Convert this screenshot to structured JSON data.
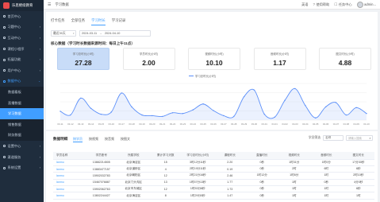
{
  "app": {
    "name": "乐思继续教育",
    "breadcrumb": "学习数据",
    "header_items": [
      {
        "label": "英语",
        "icon": "language-icon"
      },
      {
        "label": "使用帮助",
        "icon": "help-icon"
      },
      {
        "label": "任务中心",
        "icon": "task-icon"
      }
    ],
    "user_name": "admin..."
  },
  "sidebar": {
    "items": [
      {
        "label": "首页中心",
        "level": "top",
        "arrow": "",
        "active": false
      },
      {
        "label": "习题中心",
        "level": "top",
        "arrow": "›",
        "active": false
      },
      {
        "label": "互动中心",
        "level": "top",
        "arrow": "›",
        "active": false
      },
      {
        "label": "课程小程序",
        "level": "top",
        "arrow": "›",
        "active": false
      },
      {
        "label": "拓展功能",
        "level": "top",
        "arrow": "›",
        "active": false
      },
      {
        "label": "用户中心",
        "level": "top",
        "arrow": "›",
        "active": false
      },
      {
        "label": "数据中心",
        "level": "parent-open",
        "arrow": "⌄",
        "active": false
      },
      {
        "label": "数据看板",
        "level": "sub",
        "arrow": "",
        "active": false
      },
      {
        "label": "直播数据",
        "level": "sub",
        "arrow": "",
        "active": false
      },
      {
        "label": "学习数据",
        "level": "sub",
        "arrow": "",
        "active": true
      },
      {
        "label": "销售数据",
        "level": "sub",
        "arrow": "",
        "active": false
      },
      {
        "label": "财务数据",
        "level": "sub",
        "arrow": "",
        "active": false
      },
      {
        "label": "设置中心",
        "level": "top",
        "arrow": "›",
        "active": false
      },
      {
        "label": "渠道服务",
        "level": "top",
        "arrow": "›",
        "active": false
      },
      {
        "label": "系统设置",
        "level": "top",
        "arrow": "›",
        "active": false
      }
    ]
  },
  "tabs": [
    {
      "label": "打卡任务",
      "active": false
    },
    {
      "label": "全部任务",
      "active": false
    },
    {
      "label": "学习时长",
      "active": true
    },
    {
      "label": "学习记录",
      "active": false
    }
  ],
  "filters": {
    "period": "最近30天",
    "date_start": "2024-03-11",
    "date_sep": "→",
    "date_end": "2024-04-10"
  },
  "data_title": "核心数据（学习时长数据来源时间：每日上午11点）",
  "stats": [
    {
      "label": "学习总时长(小时)",
      "value": "27.28",
      "active": true
    },
    {
      "label": "学员时长(小时)",
      "value": "2.00",
      "active": false
    },
    {
      "label": "视频时长(小时)",
      "value": "10.10",
      "active": false
    },
    {
      "label": "音频时长(小时)",
      "value": "1.17",
      "active": false
    },
    {
      "label": "图文时长(小时)",
      "value": "4.88",
      "active": false
    }
  ],
  "chart_data": {
    "type": "area",
    "series": [
      {
        "name": "学习总时长(小时)",
        "values": [
          0.6,
          0.35,
          1.5,
          0.8,
          0.4,
          0.55,
          1.85,
          0.9,
          0.35,
          0.3,
          0.25,
          0.5,
          0.45,
          0.7,
          1.1,
          0.65,
          0.3,
          0.25,
          1.6,
          2.05,
          0.4,
          0.2,
          1.35,
          2.15,
          1.0,
          0.15,
          0.9,
          1.2,
          0.35,
          0.85,
          0.45
        ]
      }
    ],
    "categories": [
      "03-11",
      "03-12",
      "03-13",
      "03-14",
      "03-15",
      "03-16",
      "03-17",
      "03-18",
      "03-19",
      "03-20",
      "03-21",
      "03-22",
      "03-23",
      "03-24",
      "03-25",
      "03-26",
      "03-27",
      "03-28",
      "03-29",
      "03-30",
      "03-31",
      "04-01",
      "04-02",
      "04-03",
      "04-04",
      "04-05",
      "04-06",
      "04-07",
      "04-08",
      "04-09",
      "04-10"
    ],
    "ylim": [
      0,
      2.5
    ],
    "grid": true,
    "legend": "top-center",
    "color": "#5b8ff9"
  },
  "list": {
    "title": "数据明细",
    "subtabs": [
      {
        "label": "按学员",
        "active": true
      },
      {
        "label": "按视频",
        "active": false
      },
      {
        "label": "按音频",
        "active": false
      },
      {
        "label": "按图文",
        "active": false
      }
    ],
    "sort_label": "学员筛选",
    "sort_value": "名称",
    "search_placeholder": "请输入搜索",
    "columns": [
      "学员名称",
      "学员账号",
      "所属学校",
      "累计学习天数",
      "学习总时长(小时)",
      "课程时长",
      "直播时长",
      "视频时长",
      "音频时长",
      "图文时长"
    ],
    "rows": [
      [
        "lanmu",
        "13882214505",
        "北京海淀区",
        "15",
        "3时12分11秒",
        "2.20",
        "0秒",
        "1时31分",
        "1时0分",
        "17分30秒"
      ],
      [
        "lanmu",
        "13883477157",
        "北京道桥区",
        "4",
        "2时19分11秒",
        "0.19",
        "0秒",
        "2时",
        "6时",
        "6秒"
      ],
      [
        "lanmu",
        "15902032783",
        "北京朝阳区",
        "12",
        "2时21分16秒",
        "2.46",
        "1时12分",
        "1时6分",
        "1时",
        "2时10秒"
      ],
      [
        "lanmu",
        "15467076887",
        "北京门头沟区",
        "13",
        "1时57分13秒",
        "1.77",
        "0秒",
        "1时",
        "0秒",
        "4分0秒"
      ],
      [
        "lanmu",
        "15902062763",
        "北京市东城区",
        "12",
        "1时53分8秒",
        "1.73",
        "0秒",
        "1时",
        "1时",
        "6秒"
      ],
      [
        "lanmu",
        "13802244427",
        "北京海淀区",
        "8",
        "1时29分0秒",
        "1.47",
        "0秒",
        "1时",
        "1时",
        "1时"
      ]
    ]
  }
}
